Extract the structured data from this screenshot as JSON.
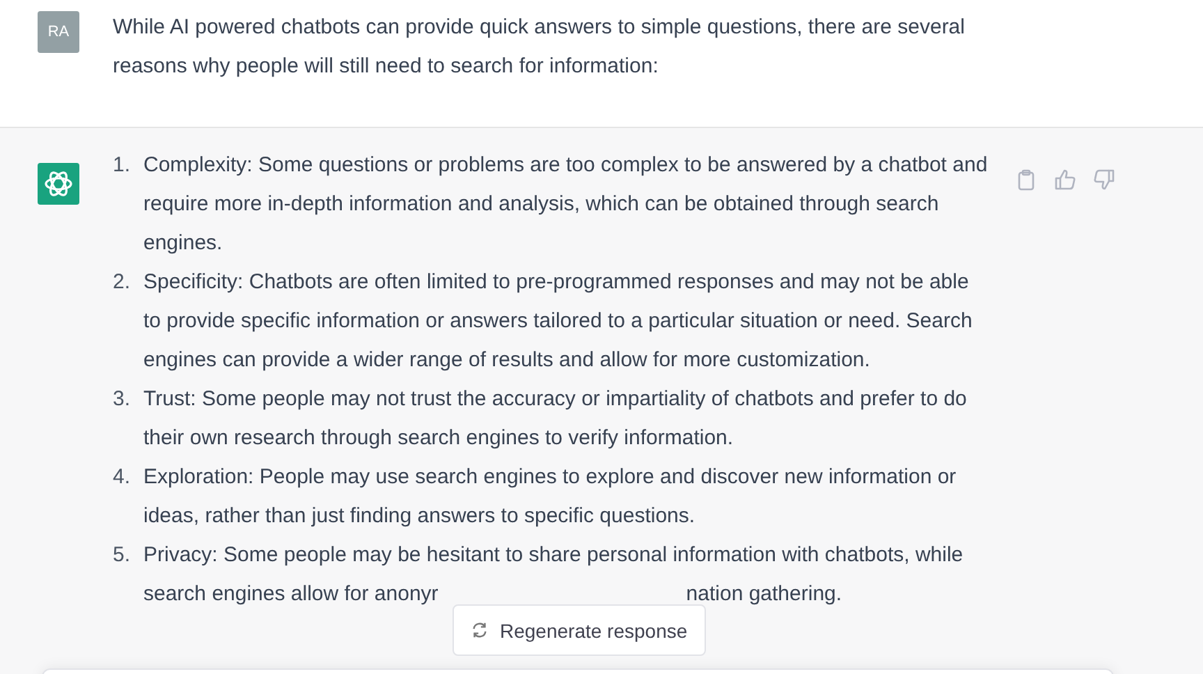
{
  "user_message": {
    "avatar": "RA",
    "text": "While AI powered chatbots can provide quick answers to simple questions, there are several reasons why people will still need to search for information:"
  },
  "assistant_message": {
    "items": [
      {
        "number": "1.",
        "text": "Complexity: Some questions or problems are too complex to be answered by a chatbot and require more in-depth information and analysis, which can be obtained through search engines."
      },
      {
        "number": "2.",
        "text": "Specificity: Chatbots are often limited to pre-programmed responses and may not be able to provide specific information or answers tailored to a particular situation or need. Search engines can provide a wider range of results and allow for more customization."
      },
      {
        "number": "3.",
        "text": "Trust: Some people may not trust the accuracy or impartiality of chatbots and prefer to do their own research through search engines to verify information."
      },
      {
        "number": "4.",
        "text": "Exploration: People may use search engines to explore and discover new information or ideas, rather than just finding answers to specific questions."
      },
      {
        "number": "5.",
        "text": "Privacy: Some people may be hesitant to share personal information with chatbots, while search engines allow for anonyr",
        "text_after_cover": "nation gathering."
      }
    ]
  },
  "regenerate_button": {
    "label": "Regenerate response"
  }
}
